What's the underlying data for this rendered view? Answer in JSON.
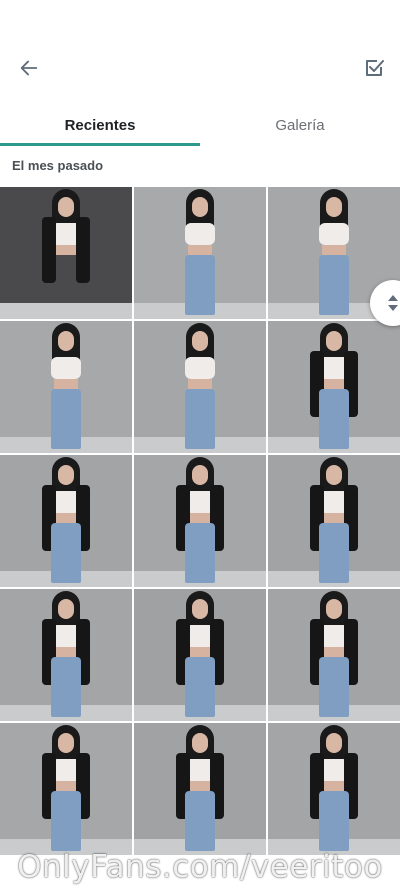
{
  "header": {
    "back_icon": "arrow-left-icon",
    "select_icon": "checkbox-checked-icon",
    "icon_color": "#5f6c7a"
  },
  "tabs": [
    {
      "label": "Recientes",
      "active": true
    },
    {
      "label": "Galería",
      "active": false
    }
  ],
  "accent_color": "#2e9a8e",
  "section": {
    "label": "El mes pasado"
  },
  "photos": [
    {
      "wall": "#4a4a4c",
      "jacket": true,
      "jeans": false
    },
    {
      "wall": "#a7a9ab",
      "jacket": false,
      "jeans": true
    },
    {
      "wall": "#a5a7a9",
      "jacket": false,
      "jeans": true
    },
    {
      "wall": "#a6a8aa",
      "jacket": false,
      "jeans": true
    },
    {
      "wall": "#a4a6a8",
      "jacket": false,
      "jeans": true
    },
    {
      "wall": "#a3a5a7",
      "jacket": true,
      "jeans": true
    },
    {
      "wall": "#a2a4a6",
      "jacket": true,
      "jeans": true
    },
    {
      "wall": "#a4a6a8",
      "jacket": true,
      "jeans": true
    },
    {
      "wall": "#a1a3a5",
      "jacket": true,
      "jeans": true
    },
    {
      "wall": "#a3a5a7",
      "jacket": true,
      "jeans": true
    },
    {
      "wall": "#9fa1a3",
      "jacket": true,
      "jeans": true
    },
    {
      "wall": "#a2a4a6",
      "jacket": true,
      "jeans": true
    },
    {
      "wall": "#a5a7a9",
      "jacket": true,
      "jeans": true
    },
    {
      "wall": "#a0a2a4",
      "jacket": true,
      "jeans": true
    },
    {
      "wall": "#a3a5a7",
      "jacket": true,
      "jeans": true
    }
  ],
  "scroll_handle_icon": "scroll-up-down-icon",
  "watermark": "OnlyFans.com/veeritoo"
}
